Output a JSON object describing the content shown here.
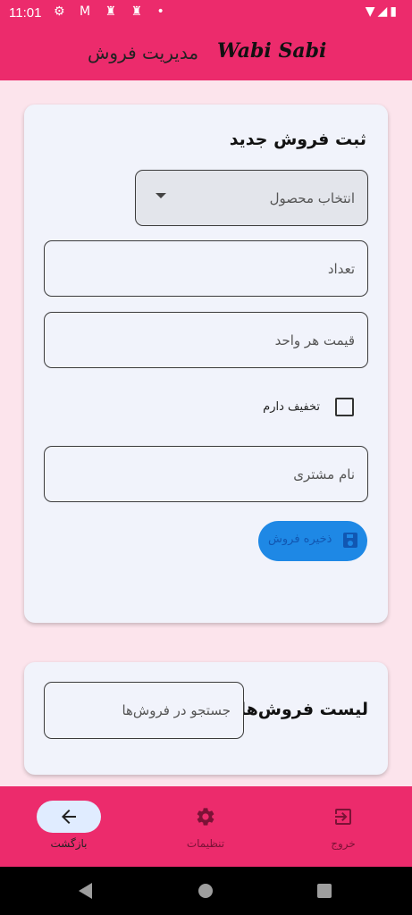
{
  "status_bar": {
    "time": "11:01",
    "left_icons": "⚙ M ♜ ♜ •",
    "right_icons": "▼◢▮"
  },
  "app_bar": {
    "title": "مدیریت فروش",
    "logo": "Wabi Sabi",
    "background_color": "#ec2b6c"
  },
  "new_sale_form": {
    "title": "ثبت فروش جدید",
    "product_select": {
      "placeholder": "انتخاب محصول"
    },
    "quantity_field": {
      "placeholder": "تعداد",
      "value": ""
    },
    "unit_price_field": {
      "placeholder": "قیمت هر واحد",
      "value": ""
    },
    "discount_checkbox": {
      "label": "تخفیف دارم",
      "checked": false
    },
    "customer_name_field": {
      "placeholder": "نام مشتری",
      "value": ""
    },
    "save_button": {
      "label": "ذخیره فروش",
      "icon": "save-icon",
      "enabled": false
    }
  },
  "sales_list": {
    "title": "لیست فروش‌ها",
    "search": {
      "placeholder": "جستجو در فروش‌ها",
      "value": ""
    }
  },
  "bottom_nav": {
    "items": [
      {
        "label": "بازگشت",
        "icon": "arrow-back-icon",
        "active": true
      },
      {
        "label": "تنظیمات",
        "icon": "settings-icon",
        "active": false
      },
      {
        "label": "خروج",
        "icon": "logout-icon",
        "active": false
      }
    ]
  },
  "colors": {
    "accent": "#ec2b6c",
    "page_background": "#fce4ec",
    "card_background": "#f1f3fb",
    "button_blue": "#1e88e5"
  }
}
